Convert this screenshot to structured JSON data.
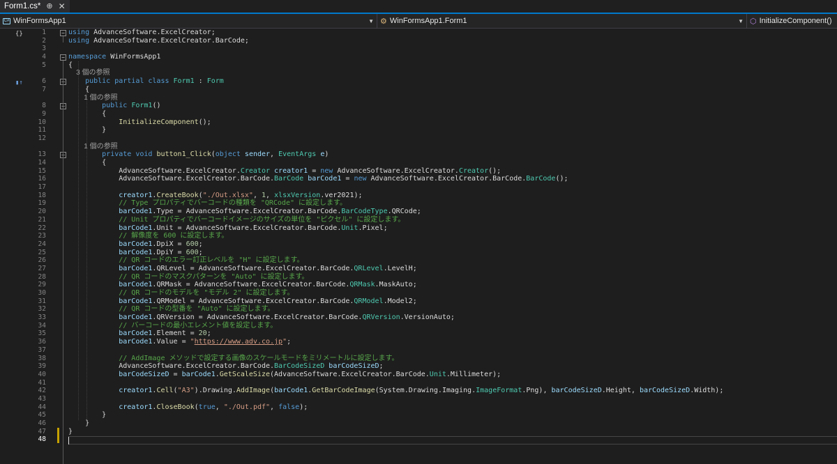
{
  "tab": {
    "title": "Form1.cs*",
    "pin": "⊕",
    "close": "✕"
  },
  "nav": {
    "project": "WinFormsApp1",
    "class": "WinFormsApp1.Form1",
    "member": "InitializeComponent()"
  },
  "line_numbers": [
    "1",
    "2",
    "3",
    "4",
    "5",
    "",
    "6",
    "7",
    "",
    "8",
    "9",
    "10",
    "11",
    "12",
    "",
    "13",
    "14",
    "15",
    "16",
    "17",
    "18",
    "19",
    "20",
    "21",
    "22",
    "23",
    "24",
    "25",
    "26",
    "27",
    "28",
    "29",
    "30",
    "31",
    "32",
    "33",
    "34",
    "35",
    "36",
    "37",
    "38",
    "39",
    "40",
    "41",
    "42",
    "43",
    "44",
    "45",
    "46",
    "47",
    "48"
  ],
  "code_lines": [
    [
      {
        "c": "kw",
        "t": "using"
      },
      {
        "c": "ns",
        "t": " AdvanceSoftware.ExcelCreator;"
      }
    ],
    [
      {
        "c": "kw",
        "t": "using"
      },
      {
        "c": "ns",
        "t": " AdvanceSoftware.ExcelCreator.BarCode;"
      }
    ],
    [
      {
        "c": "ns",
        "t": ""
      }
    ],
    [
      {
        "c": "kw",
        "t": "namespace"
      },
      {
        "c": "ns",
        "t": " WinFormsApp1"
      }
    ],
    [
      {
        "c": "ns",
        "t": "{"
      }
    ],
    [
      {
        "c": "lens",
        "t": "    3 個の参照"
      }
    ],
    [
      {
        "c": "kw",
        "t": "    public partial class"
      },
      {
        "c": "ns",
        "t": " "
      },
      {
        "c": "ty",
        "t": "Form1"
      },
      {
        "c": "ns",
        "t": " : "
      },
      {
        "c": "ty",
        "t": "Form"
      }
    ],
    [
      {
        "c": "ns",
        "t": "    {"
      }
    ],
    [
      {
        "c": "lens",
        "t": "        1 個の参照"
      }
    ],
    [
      {
        "c": "kw",
        "t": "        public"
      },
      {
        "c": "ns",
        "t": " "
      },
      {
        "c": "ty",
        "t": "Form1"
      },
      {
        "c": "ns",
        "t": "()"
      }
    ],
    [
      {
        "c": "ns",
        "t": "        {"
      }
    ],
    [
      {
        "c": "ns",
        "t": "            "
      },
      {
        "c": "mt",
        "t": "InitializeComponent"
      },
      {
        "c": "ns",
        "t": "();"
      }
    ],
    [
      {
        "c": "ns",
        "t": "        }"
      }
    ],
    [
      {
        "c": "ns",
        "t": ""
      }
    ],
    [
      {
        "c": "lens",
        "t": "        1 個の参照"
      }
    ],
    [
      {
        "c": "kw",
        "t": "        private void"
      },
      {
        "c": "ns",
        "t": " "
      },
      {
        "c": "mt",
        "t": "button1_Click"
      },
      {
        "c": "ns",
        "t": "("
      },
      {
        "c": "kw",
        "t": "object"
      },
      {
        "c": "ns",
        "t": " "
      },
      {
        "c": "pm",
        "t": "sender"
      },
      {
        "c": "ns",
        "t": ", "
      },
      {
        "c": "ty",
        "t": "EventArgs"
      },
      {
        "c": "ns",
        "t": " "
      },
      {
        "c": "pm",
        "t": "e"
      },
      {
        "c": "ns",
        "t": ")"
      }
    ],
    [
      {
        "c": "ns",
        "t": "        {"
      }
    ],
    [
      {
        "c": "ns",
        "t": "            AdvanceSoftware.ExcelCreator."
      },
      {
        "c": "ty",
        "t": "Creator"
      },
      {
        "c": "ns",
        "t": " "
      },
      {
        "c": "pm",
        "t": "creator1"
      },
      {
        "c": "ns",
        "t": " = "
      },
      {
        "c": "kw",
        "t": "new"
      },
      {
        "c": "ns",
        "t": " AdvanceSoftware.ExcelCreator."
      },
      {
        "c": "ty",
        "t": "Creator"
      },
      {
        "c": "ns",
        "t": "();"
      }
    ],
    [
      {
        "c": "ns",
        "t": "            AdvanceSoftware.ExcelCreator.BarCode."
      },
      {
        "c": "ty",
        "t": "BarCode"
      },
      {
        "c": "ns",
        "t": " "
      },
      {
        "c": "pm",
        "t": "barCode1"
      },
      {
        "c": "ns",
        "t": " = "
      },
      {
        "c": "kw",
        "t": "new"
      },
      {
        "c": "ns",
        "t": " AdvanceSoftware.ExcelCreator.BarCode."
      },
      {
        "c": "ty",
        "t": "BarCode"
      },
      {
        "c": "ns",
        "t": "();"
      }
    ],
    [
      {
        "c": "ns",
        "t": ""
      }
    ],
    [
      {
        "c": "ns",
        "t": "            "
      },
      {
        "c": "pm",
        "t": "creator1"
      },
      {
        "c": "ns",
        "t": "."
      },
      {
        "c": "mt",
        "t": "CreateBook"
      },
      {
        "c": "ns",
        "t": "("
      },
      {
        "c": "st",
        "t": "\"./Out.xlsx\""
      },
      {
        "c": "ns",
        "t": ", "
      },
      {
        "c": "nm",
        "t": "1"
      },
      {
        "c": "ns",
        "t": ", "
      },
      {
        "c": "ty",
        "t": "xlsxVersion"
      },
      {
        "c": "ns",
        "t": ".ver2021);"
      }
    ],
    [
      {
        "c": "cm",
        "t": "            // Type プロパティでバーコードの種類を \"QRCode\" に設定します。"
      }
    ],
    [
      {
        "c": "ns",
        "t": "            "
      },
      {
        "c": "pm",
        "t": "barCode1"
      },
      {
        "c": "ns",
        "t": ".Type = AdvanceSoftware.ExcelCreator.BarCode."
      },
      {
        "c": "ty",
        "t": "BarCodeType"
      },
      {
        "c": "ns",
        "t": ".QRCode;"
      }
    ],
    [
      {
        "c": "cm",
        "t": "            // Unit プロパティでバーコードイメージのサイズの単位を \"ピクセル\" に設定します。"
      }
    ],
    [
      {
        "c": "ns",
        "t": "            "
      },
      {
        "c": "pm",
        "t": "barCode1"
      },
      {
        "c": "ns",
        "t": ".Unit = AdvanceSoftware.ExcelCreator.BarCode."
      },
      {
        "c": "ty",
        "t": "Unit"
      },
      {
        "c": "ns",
        "t": ".Pixel;"
      }
    ],
    [
      {
        "c": "cm",
        "t": "            // 解像度を 600 に設定します。"
      }
    ],
    [
      {
        "c": "ns",
        "t": "            "
      },
      {
        "c": "pm",
        "t": "barCode1"
      },
      {
        "c": "ns",
        "t": ".DpiX = "
      },
      {
        "c": "nm",
        "t": "600"
      },
      {
        "c": "ns",
        "t": ";"
      }
    ],
    [
      {
        "c": "ns",
        "t": "            "
      },
      {
        "c": "pm",
        "t": "barCode1"
      },
      {
        "c": "ns",
        "t": ".DpiY = "
      },
      {
        "c": "nm",
        "t": "600"
      },
      {
        "c": "ns",
        "t": ";"
      }
    ],
    [
      {
        "c": "cm",
        "t": "            // QR コードのエラー訂正レベルを \"H\" に設定します。"
      }
    ],
    [
      {
        "c": "ns",
        "t": "            "
      },
      {
        "c": "pm",
        "t": "barCode1"
      },
      {
        "c": "ns",
        "t": ".QRLevel = AdvanceSoftware.ExcelCreator.BarCode."
      },
      {
        "c": "ty",
        "t": "QRLevel"
      },
      {
        "c": "ns",
        "t": ".LevelH;"
      }
    ],
    [
      {
        "c": "cm",
        "t": "            // QR コードのマスクパターンを \"Auto\" に設定します。"
      }
    ],
    [
      {
        "c": "ns",
        "t": "            "
      },
      {
        "c": "pm",
        "t": "barCode1"
      },
      {
        "c": "ns",
        "t": ".QRMask = AdvanceSoftware.ExcelCreator.BarCode."
      },
      {
        "c": "ty",
        "t": "QRMask"
      },
      {
        "c": "ns",
        "t": ".MaskAuto;"
      }
    ],
    [
      {
        "c": "cm",
        "t": "            // QR コードのモデルを \"モデル 2\" に設定します。"
      }
    ],
    [
      {
        "c": "ns",
        "t": "            "
      },
      {
        "c": "pm",
        "t": "barCode1"
      },
      {
        "c": "ns",
        "t": ".QRModel = AdvanceSoftware.ExcelCreator.BarCode."
      },
      {
        "c": "ty",
        "t": "QRModel"
      },
      {
        "c": "ns",
        "t": ".Model2;"
      }
    ],
    [
      {
        "c": "cm",
        "t": "            // QR コードの型番を \"Auto\" に設定します。"
      }
    ],
    [
      {
        "c": "ns",
        "t": "            "
      },
      {
        "c": "pm",
        "t": "barCode1"
      },
      {
        "c": "ns",
        "t": ".QRVersion = AdvanceSoftware.ExcelCreator.BarCode."
      },
      {
        "c": "ty",
        "t": "QRVersion"
      },
      {
        "c": "ns",
        "t": ".VersionAuto;"
      }
    ],
    [
      {
        "c": "cm",
        "t": "            // バーコードの最小エレメント値を設定します。"
      }
    ],
    [
      {
        "c": "ns",
        "t": "            "
      },
      {
        "c": "pm",
        "t": "barCode1"
      },
      {
        "c": "ns",
        "t": ".Element = "
      },
      {
        "c": "nm",
        "t": "20"
      },
      {
        "c": "ns",
        "t": ";"
      }
    ],
    [
      {
        "c": "ns",
        "t": "            "
      },
      {
        "c": "pm",
        "t": "barCode1"
      },
      {
        "c": "ns",
        "t": ".Value = "
      },
      {
        "c": "st",
        "t": "\""
      },
      {
        "c": "url",
        "t": "https://www.adv.co.jp"
      },
      {
        "c": "st",
        "t": "\""
      },
      {
        "c": "ns",
        "t": ";"
      }
    ],
    [
      {
        "c": "ns",
        "t": ""
      }
    ],
    [
      {
        "c": "cm",
        "t": "            // AddImage メソッドで設定する画像のスケールモードをミリメートルに設定します。"
      }
    ],
    [
      {
        "c": "ns",
        "t": "            AdvanceSoftware.ExcelCreator.BarCode."
      },
      {
        "c": "ty",
        "t": "BarCodeSizeD"
      },
      {
        "c": "ns",
        "t": " "
      },
      {
        "c": "pm",
        "t": "barCodeSizeD"
      },
      {
        "c": "ns",
        "t": ";"
      }
    ],
    [
      {
        "c": "ns",
        "t": "            "
      },
      {
        "c": "pm",
        "t": "barCodeSizeD"
      },
      {
        "c": "ns",
        "t": " = "
      },
      {
        "c": "pm",
        "t": "barCode1"
      },
      {
        "c": "ns",
        "t": "."
      },
      {
        "c": "mt",
        "t": "GetScaleSize"
      },
      {
        "c": "ns",
        "t": "(AdvanceSoftware.ExcelCreator.BarCode."
      },
      {
        "c": "ty",
        "t": "Unit"
      },
      {
        "c": "ns",
        "t": ".Millimeter);"
      }
    ],
    [
      {
        "c": "ns",
        "t": ""
      }
    ],
    [
      {
        "c": "ns",
        "t": "            "
      },
      {
        "c": "pm",
        "t": "creator1"
      },
      {
        "c": "ns",
        "t": "."
      },
      {
        "c": "mt",
        "t": "Cell"
      },
      {
        "c": "ns",
        "t": "("
      },
      {
        "c": "st",
        "t": "\"A3\""
      },
      {
        "c": "ns",
        "t": ").Drawing."
      },
      {
        "c": "mt",
        "t": "AddImage"
      },
      {
        "c": "ns",
        "t": "("
      },
      {
        "c": "pm",
        "t": "barCode1"
      },
      {
        "c": "ns",
        "t": "."
      },
      {
        "c": "mt",
        "t": "GetBarCodeImage"
      },
      {
        "c": "ns",
        "t": "(System.Drawing.Imaging."
      },
      {
        "c": "ty",
        "t": "ImageFormat"
      },
      {
        "c": "ns",
        "t": ".Png), "
      },
      {
        "c": "pm",
        "t": "barCodeSizeD"
      },
      {
        "c": "ns",
        "t": ".Height, "
      },
      {
        "c": "pm",
        "t": "barCodeSizeD"
      },
      {
        "c": "ns",
        "t": ".Width);"
      }
    ],
    [
      {
        "c": "ns",
        "t": ""
      }
    ],
    [
      {
        "c": "ns",
        "t": "            "
      },
      {
        "c": "pm",
        "t": "creator1"
      },
      {
        "c": "ns",
        "t": "."
      },
      {
        "c": "mt",
        "t": "CloseBook"
      },
      {
        "c": "ns",
        "t": "("
      },
      {
        "c": "kw",
        "t": "true"
      },
      {
        "c": "ns",
        "t": ", "
      },
      {
        "c": "st",
        "t": "\"./Out.pdf\""
      },
      {
        "c": "ns",
        "t": ", "
      },
      {
        "c": "kw",
        "t": "false"
      },
      {
        "c": "ns",
        "t": ");"
      }
    ],
    [
      {
        "c": "ns",
        "t": "        }"
      }
    ],
    [
      {
        "c": "ns",
        "t": "    }"
      }
    ],
    [
      {
        "c": "ns",
        "t": "}"
      }
    ],
    [
      {
        "c": "ns",
        "t": ""
      }
    ]
  ],
  "colors": {
    "accent": "#007acc",
    "keyword": "#569cd6",
    "type": "#4ec9b0",
    "string": "#d69d85",
    "comment": "#57a64a",
    "method": "#dcdcaa",
    "param": "#9cdcfe"
  }
}
